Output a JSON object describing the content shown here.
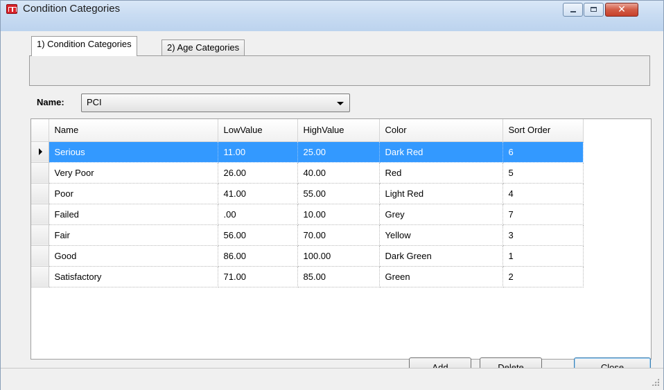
{
  "window": {
    "title": "Condition Categories",
    "icon": "app-icon",
    "controls": [
      "minimize-icon",
      "maximize-icon",
      "close-icon"
    ]
  },
  "tabs": [
    {
      "label": "1) Condition Categories",
      "active": true
    },
    {
      "label": "2) Age Categories",
      "active": false
    }
  ],
  "name_selector": {
    "label": "Name:",
    "value": "PCI"
  },
  "grid": {
    "columns": [
      "Name",
      "LowValue",
      "HighValue",
      "Color",
      "Sort Order"
    ],
    "rows": [
      {
        "name": "Serious",
        "low": "11.00",
        "high": "25.00",
        "color": "Dark Red",
        "sort": "6",
        "selected": true
      },
      {
        "name": "Very Poor",
        "low": "26.00",
        "high": "40.00",
        "color": "Red",
        "sort": "5"
      },
      {
        "name": "Poor",
        "low": "41.00",
        "high": "55.00",
        "color": "Light Red",
        "sort": "4"
      },
      {
        "name": "Failed",
        "low": ".00",
        "high": "10.00",
        "color": "Grey",
        "sort": "7"
      },
      {
        "name": "Fair",
        "low": "56.00",
        "high": "70.00",
        "color": "Yellow",
        "sort": "3"
      },
      {
        "name": "Good",
        "low": "86.00",
        "high": "100.00",
        "color": "Dark Green",
        "sort": "1"
      },
      {
        "name": "Satisfactory",
        "low": "71.00",
        "high": "85.00",
        "color": "Green",
        "sort": "2"
      }
    ]
  },
  "buttons": {
    "add": "Add",
    "delete": "Delete",
    "close": "Close"
  },
  "colors": {
    "selection": "#3399ff",
    "window_bg": "#f0f0f0"
  }
}
